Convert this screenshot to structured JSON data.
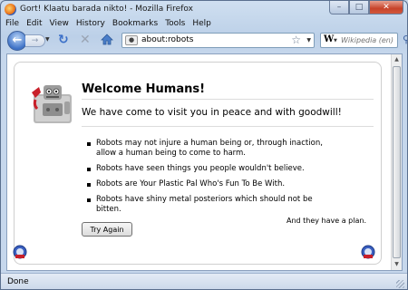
{
  "window": {
    "title": "Gort! Klaatu barada nikto! - Mozilla Firefox",
    "controls": {
      "minimize": "–",
      "maximize": "□",
      "close": "✕"
    }
  },
  "menu": [
    "File",
    "Edit",
    "View",
    "History",
    "Bookmarks",
    "Tools",
    "Help"
  ],
  "nav": {
    "url": "about:robots",
    "site_icon": "robot-favicon",
    "search_engine": "W",
    "search_placeholder": "Wikipedia (en)"
  },
  "page": {
    "heading": "Welcome Humans!",
    "subheading": "We have come to visit you in peace and with goodwill!",
    "items": [
      "Robots may not injure a human being or, through inaction, allow a human being to come to harm.",
      "Robots have seen things you people wouldn't believe.",
      "Robots are Your Plastic Pal Who's Fun To Be With.",
      "Robots have shiny metal posteriors which should not be bitten."
    ],
    "footnote": "And they have a plan.",
    "button": "Try Again"
  },
  "status": {
    "text": "Done"
  },
  "colors": {
    "accent": "#3f73c7",
    "close": "#c7432a"
  }
}
